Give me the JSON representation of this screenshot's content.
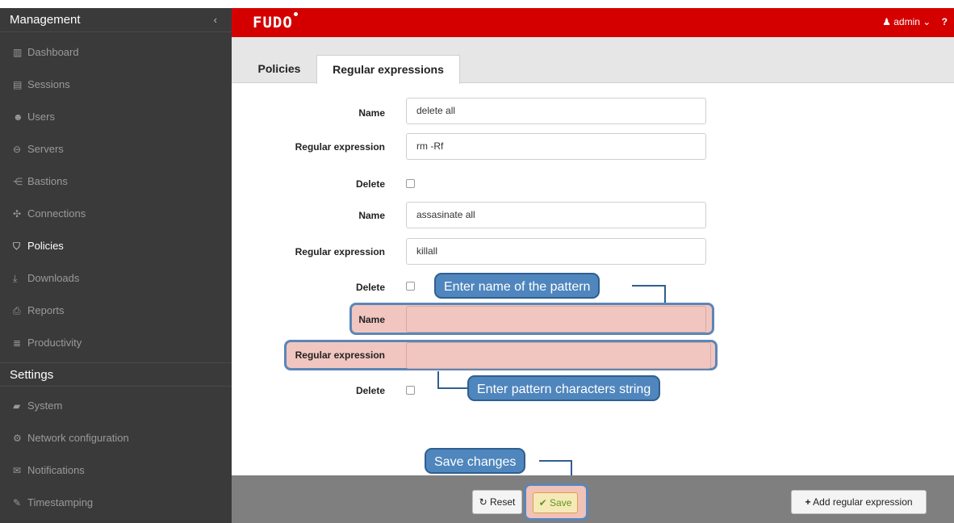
{
  "sidebar": {
    "management_title": "Management",
    "collapse_icon": "chevron-left-icon",
    "items": [
      {
        "label": "Dashboard",
        "icon": "bar-chart-icon"
      },
      {
        "label": "Sessions",
        "icon": "film-icon"
      },
      {
        "label": "Users",
        "icon": "users-icon"
      },
      {
        "label": "Servers",
        "icon": "server-icon"
      },
      {
        "label": "Bastions",
        "icon": "bastion-icon"
      },
      {
        "label": "Connections",
        "icon": "connections-icon"
      },
      {
        "label": "Policies",
        "icon": "shield-icon"
      },
      {
        "label": "Downloads",
        "icon": "download-icon"
      },
      {
        "label": "Reports",
        "icon": "print-icon"
      },
      {
        "label": "Productivity",
        "icon": "list-icon"
      }
    ],
    "settings_title": "Settings",
    "settings_items": [
      {
        "label": "System",
        "icon": "folder-icon"
      },
      {
        "label": "Network configuration",
        "icon": "cogs-icon"
      },
      {
        "label": "Notifications",
        "icon": "envelope-icon"
      },
      {
        "label": "Timestamping",
        "icon": "edit-icon"
      }
    ],
    "active": "Policies"
  },
  "topbar": {
    "logo": "FUDO",
    "user": "admin",
    "help": "?"
  },
  "tabs": [
    {
      "label": "Policies",
      "active": false
    },
    {
      "label": "Regular expressions",
      "active": true
    }
  ],
  "form": {
    "rows": [
      {
        "name_label": "Name",
        "name_value": "delete all",
        "regex_label": "Regular expression",
        "regex_value": "rm -Rf",
        "delete_label": "Delete"
      },
      {
        "name_label": "Name",
        "name_value": "assasinate all",
        "regex_label": "Regular expression",
        "regex_value": "killall",
        "delete_label": "Delete"
      },
      {
        "name_label": "Name",
        "name_value": "",
        "regex_label": "Regular expression",
        "regex_value": "",
        "delete_label": "Delete"
      }
    ]
  },
  "callouts": {
    "name": "Enter name of the pattern",
    "pattern": "Enter pattern characters string",
    "save": "Save changes"
  },
  "footer": {
    "reset": "Reset",
    "save": "Save",
    "add": "Add regular expression"
  },
  "colors": {
    "topbar": "#d40000",
    "sidebar": "#3a3a3a",
    "callout": "#4f86bd",
    "highlight": "#f1c6c0"
  }
}
